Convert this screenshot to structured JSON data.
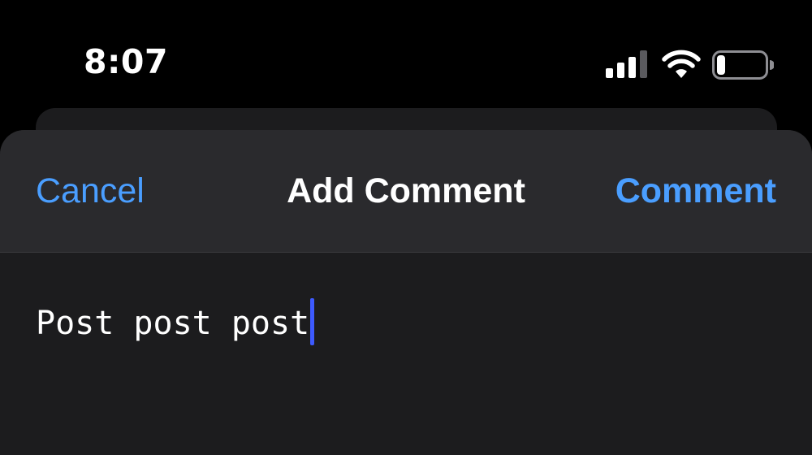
{
  "status_bar": {
    "time": "8:07",
    "icons": [
      "cellular-signal-icon",
      "wifi-icon",
      "battery-icon"
    ]
  },
  "sheet": {
    "cancel_label": "Cancel",
    "title": "Add Comment",
    "submit_label": "Comment"
  },
  "editor": {
    "value": "Post post post"
  },
  "colors": {
    "accent": "#4a9eff",
    "caret": "#3d5afe",
    "sheet_background": "#1c1c1e",
    "nav_background": "#2a2a2d"
  }
}
